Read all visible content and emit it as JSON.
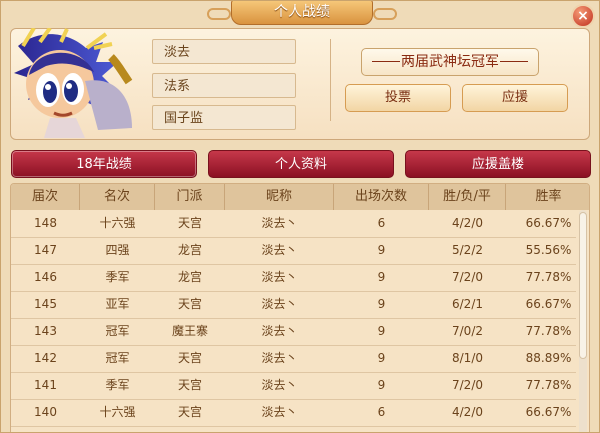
{
  "window": {
    "title": "个人战绩"
  },
  "profile": {
    "name": "淡去",
    "school": "法系",
    "position": "国子监",
    "award": "两届武神坛冠军",
    "buttons": {
      "vote": "投票",
      "support": "应援"
    }
  },
  "tabs": [
    "18年战绩",
    "个人资料",
    "应援盖楼"
  ],
  "table": {
    "headers": [
      "届次",
      "名次",
      "门派",
      "昵称",
      "出场次数",
      "胜/负/平",
      "胜率"
    ],
    "rows": [
      [
        "148",
        "十六强",
        "天宫",
        "淡去丶",
        "6",
        "4/2/0",
        "66.67%"
      ],
      [
        "147",
        "四强",
        "龙宫",
        "淡去丶",
        "9",
        "5/2/2",
        "55.56%"
      ],
      [
        "146",
        "季军",
        "龙宫",
        "淡去丶",
        "9",
        "7/2/0",
        "77.78%"
      ],
      [
        "145",
        "亚军",
        "天宫",
        "淡去丶",
        "9",
        "6/2/1",
        "66.67%"
      ],
      [
        "143",
        "冠军",
        "魔王寨",
        "淡去丶",
        "9",
        "7/0/2",
        "77.78%"
      ],
      [
        "142",
        "冠军",
        "天宫",
        "淡去丶",
        "9",
        "8/1/0",
        "88.89%"
      ],
      [
        "141",
        "季军",
        "天宫",
        "淡去丶",
        "9",
        "7/2/0",
        "77.78%"
      ],
      [
        "140",
        "十六强",
        "天宫",
        "淡去丶",
        "6",
        "4/2/0",
        "66.67%"
      ]
    ]
  },
  "icons": {
    "close": "close-icon"
  },
  "colors": {
    "panel": "#efdbb8",
    "tab": "#a91d32",
    "text": "#6b431c"
  }
}
